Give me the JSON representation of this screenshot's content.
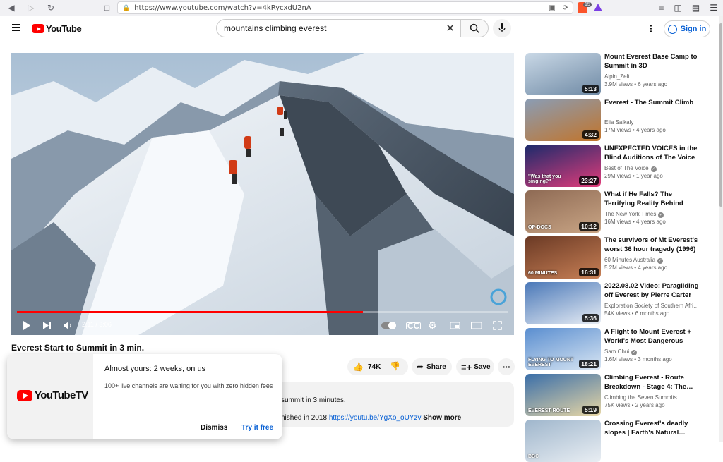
{
  "browser": {
    "url": "https://www.youtube.com/watch?v=4kRycxdU2nA",
    "brave_badge": "15"
  },
  "header": {
    "logo_text": "YouTube",
    "search_value": "mountains climbing everest",
    "signin_label": "Sign in"
  },
  "player": {
    "time": "2:11 / 3:06",
    "progress_fraction": 0.704
  },
  "video": {
    "title": "Everest Start to Summit in 3 min.",
    "likes": "74K",
    "share_label": "Share",
    "save_label": "Save",
    "desc_line1": "summit in 3 minutes.",
    "desc_line2_prefix": "nished in 2018 ",
    "desc_link": "https://youtu.be/YgXo_oUYzv",
    "show_more": "Show more"
  },
  "popup": {
    "brand": "YouTubeTV",
    "heading": "Almost yours: 2 weeks, on us",
    "subtext": "100+ live channels are waiting for you with zero hidden fees",
    "dismiss": "Dismiss",
    "try": "Try it free"
  },
  "recommendations": [
    {
      "title": "Mount Everest Base Camp to Summit in 3D",
      "channel": "Alpin_Zelt",
      "verified": false,
      "meta": "3.9M views • 6 years ago",
      "duration": "5:13",
      "colors": [
        "#c9d8e6",
        "#6f8aa5"
      ]
    },
    {
      "title": "Everest - The Summit Climb",
      "channel": "Elia Saikaly",
      "verified": false,
      "meta": "17M views • 4 years ago",
      "duration": "4:32",
      "colors": [
        "#8a9db5",
        "#c2742a"
      ]
    },
    {
      "title": "UNEXPECTED VOICES in the Blind Auditions of The Voice |…",
      "channel": "Best of The Voice",
      "verified": true,
      "meta": "29M views • 1 year ago",
      "duration": "23:27",
      "colors": [
        "#1b2a6b",
        "#e23c7a"
      ],
      "overlay": "\"Was that you singing?\""
    },
    {
      "title": "What if He Falls? The Terrifying Reality Behind Filming \"Free…",
      "channel": "The New York Times",
      "verified": true,
      "meta": "16M views • 4 years ago",
      "duration": "10:12",
      "colors": [
        "#8e6a54",
        "#c9a585"
      ],
      "overlay": "OP-DOCS"
    },
    {
      "title": "The survivors of Mt Everest's worst 36 hour tragedy (1996) |…",
      "channel": "60 Minutes Australia",
      "verified": true,
      "meta": "5.2M views • 4 years ago",
      "duration": "16:31",
      "colors": [
        "#6b3a25",
        "#c77f55"
      ],
      "overlay": "60 MINUTES"
    },
    {
      "title": "2022.08.02 Video: Paragliding off Everest by Pierre Carter",
      "channel": "Exploration Society of Southern Afri…",
      "verified": false,
      "meta": "54K views • 6 months ago",
      "duration": "5:36",
      "colors": [
        "#4a78b8",
        "#e9eef5"
      ]
    },
    {
      "title": "A Flight to Mount Everest + World's Most Dangerous Airpo…",
      "channel": "Sam Chui",
      "verified": true,
      "meta": "1.6M views • 3 months ago",
      "duration": "18:21",
      "colors": [
        "#5a8ed0",
        "#d9e6f3"
      ],
      "overlay": "FLYING TO MOUNT EVEREST"
    },
    {
      "title": "Climbing Everest - Route Breakdown - Stage 4: The…",
      "channel": "Climbing the Seven Summits",
      "verified": false,
      "meta": "75K views • 2 years ago",
      "duration": "5:19",
      "colors": [
        "#3a6ea8",
        "#e8d7a6"
      ],
      "overlay": "EVEREST ROUTE"
    },
    {
      "title": "Crossing Everest's deadly slopes | Earth's Natural…",
      "channel": "",
      "verified": false,
      "meta": "",
      "duration": "",
      "colors": [
        "#9fb6cc",
        "#e9eef3"
      ],
      "overlay": "BBC"
    }
  ]
}
